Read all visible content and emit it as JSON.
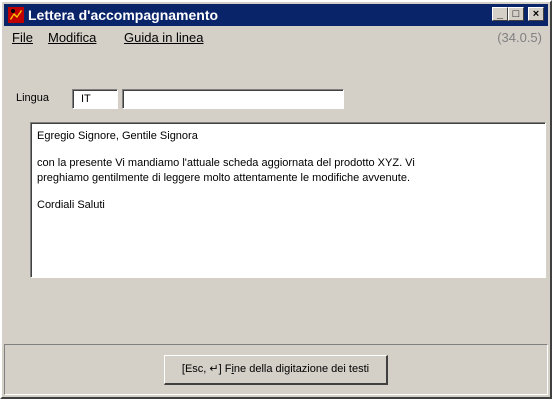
{
  "window": {
    "title": "Lettera d'accompagnamento",
    "version": "(34.0.5)"
  },
  "menu": {
    "file_label": "File",
    "modifica_label": "Modifica",
    "guida_label": "Guida in linea"
  },
  "language": {
    "label": "Lingua",
    "code": "IT",
    "name": ""
  },
  "letter": {
    "lines": [
      "Egregio Signore, Gentile Signora",
      "con la presente Vi mandiamo l'attuale scheda aggiornata del prodotto XYZ. Vi",
      "preghiamo gentilmente di leggere molto attentamente le modifiche avvenute.",
      "Cordiali Saluti"
    ]
  },
  "footer": {
    "finish_prefix": "[Esc, ↵] F",
    "finish_mnemonic": "i",
    "finish_suffix": "ne della digitazione dei testi"
  },
  "icons": {
    "app": "app-icon",
    "minimize": "minimize-icon",
    "maximize": "maximize-icon",
    "close": "close-icon"
  },
  "colors": {
    "titlebar": "#0a246a",
    "face": "#d4d0c8",
    "version_text": "#808080"
  }
}
